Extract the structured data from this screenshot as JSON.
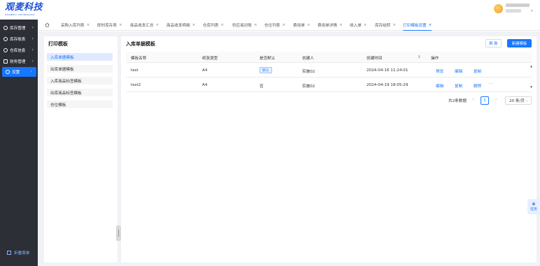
{
  "app": {
    "logo_text": "观麦科技",
    "logo_sub": "GUANMAI TECHNOLOGY"
  },
  "sidebar": {
    "items": [
      {
        "label": "库存管理"
      },
      {
        "label": "库存账表"
      },
      {
        "label": "仓库信息"
      },
      {
        "label": "财务管理"
      },
      {
        "label": "设置"
      }
    ],
    "collapse_label": "折叠菜单"
  },
  "tabs": [
    {
      "label": "采购入库列表"
    },
    {
      "label": "即时库存表"
    },
    {
      "label": "商品收发汇总"
    },
    {
      "label": "商品收发明细"
    },
    {
      "label": "仓库列表"
    },
    {
      "label": "供应商对账"
    },
    {
      "label": "仓位列表"
    },
    {
      "label": "费用单"
    },
    {
      "label": "费用单详情"
    },
    {
      "label": "收入单"
    },
    {
      "label": "库存结转"
    },
    {
      "label": "打印模板设置"
    }
  ],
  "left_panel": {
    "title": "打印模板",
    "items": [
      {
        "label": "入库单据模板"
      },
      {
        "label": "出库单据模板"
      },
      {
        "label": "入库商品标签模板"
      },
      {
        "label": "出库商品标签模板"
      },
      {
        "label": "仓位模板"
      }
    ]
  },
  "main": {
    "title": "入库单据模板",
    "refresh_label": "刷 新",
    "new_label": "新建模板",
    "columns": [
      "模板名称",
      "纸张类型",
      "是否默认",
      "创建人",
      "创建时间",
      "操作"
    ],
    "rows": [
      {
        "name": "test",
        "paper": "A4",
        "default": "默认",
        "creator": "实施02",
        "created": "2024-04-16 11:24:01",
        "actions": [
          "预览",
          "编辑",
          "复制"
        ],
        "more": ""
      },
      {
        "name": "test2",
        "paper": "A4",
        "default": "否",
        "creator": "实施02",
        "created": "2024-04-19 18:05:29",
        "actions": [
          "编辑",
          "复制",
          "删除"
        ],
        "more": "···"
      }
    ],
    "pager": {
      "total": "共2条数据",
      "prev": "<",
      "page": "1",
      "next": ">",
      "size": "20 条/页"
    }
  },
  "float_task": {
    "label": "任务"
  },
  "colors": {
    "primary": "#1677ff",
    "sidebar_bg": "#2c2f36",
    "content_bg": "#f0f2f5"
  }
}
